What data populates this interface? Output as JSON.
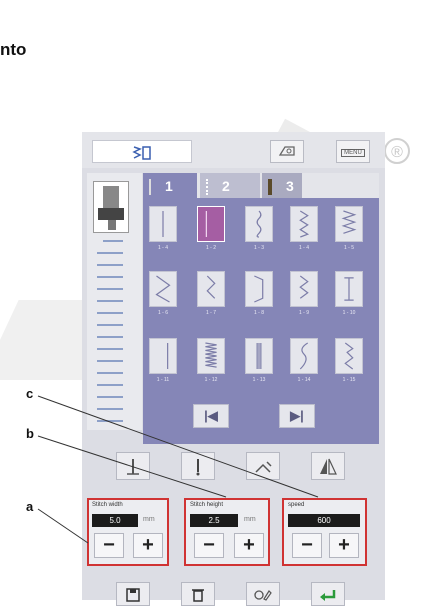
{
  "heading": "nto",
  "registered_mark": "®",
  "colors": {
    "stitch_panel": "#8586b7",
    "selected_stitch": "#a55ea3",
    "control_highlight": "#d03333",
    "ok_button": "#2a9a3a"
  },
  "top_bar": {
    "mode_icon": "stitch-mode-icon",
    "button1_icon": "bobbin-icon",
    "button2_icon": "menu-icon",
    "button2_label": "MENU"
  },
  "tabs": [
    {
      "label": "1",
      "icon": "straight-stitch-tab-icon"
    },
    {
      "label": "2",
      "icon": "decorative-stitch-tab-icon"
    },
    {
      "label": "3",
      "icon": "buttonhole-tab-icon"
    }
  ],
  "stitches": [
    {
      "code": "1 - 4",
      "icon": "straight"
    },
    {
      "code": "1 - 2",
      "icon": "straight-left",
      "selected": true
    },
    {
      "code": "1 - 3",
      "icon": "wave"
    },
    {
      "code": "1 - 4",
      "icon": "zigzag"
    },
    {
      "code": "1 - 5",
      "icon": "triple-zigzag"
    },
    {
      "code": "1 - 6",
      "icon": "wide-zigzag"
    },
    {
      "code": "1 - 7",
      "icon": "narrow-zigzag"
    },
    {
      "code": "1 - 8",
      "icon": "overlock"
    },
    {
      "code": "1 - 9",
      "icon": "blind-hem"
    },
    {
      "code": "1 - 10",
      "icon": "bar"
    },
    {
      "code": "1 - 11",
      "icon": "straight-right"
    },
    {
      "code": "1 - 12",
      "icon": "dense-zigzag"
    },
    {
      "code": "1 - 13",
      "icon": "triple-straight"
    },
    {
      "code": "1 - 14",
      "icon": "serpentine"
    },
    {
      "code": "1 - 15",
      "icon": "shell"
    }
  ],
  "nav": {
    "prev_icon": "first-page-icon",
    "next_icon": "last-page-icon"
  },
  "functions": [
    {
      "icon": "needle-up-down-icon"
    },
    {
      "icon": "needle-position-icon"
    },
    {
      "icon": "tie-off-icon"
    },
    {
      "icon": "mirror-icon"
    }
  ],
  "controls": {
    "stitch_width": {
      "label": "Stitch width",
      "value": "5.0",
      "unit": "mm"
    },
    "stitch_height": {
      "label": "Stitch height",
      "value": "2.5",
      "unit": "mm"
    },
    "speed": {
      "label": "speed",
      "value": "600"
    },
    "minus": "−",
    "plus": "+"
  },
  "bottom_buttons": [
    {
      "icon": "save-icon"
    },
    {
      "icon": "delete-icon"
    },
    {
      "icon": "clear-settings-icon"
    },
    {
      "icon": "enter-icon"
    }
  ],
  "callouts": {
    "a": "a",
    "b": "b",
    "c": "c"
  }
}
